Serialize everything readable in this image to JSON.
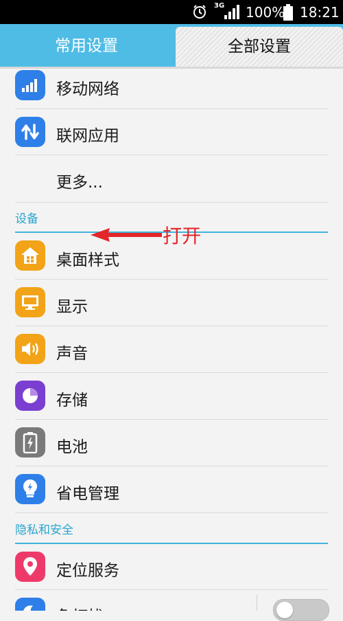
{
  "status_bar": {
    "network": "3G",
    "battery": "100%",
    "time": "18:21"
  },
  "tabs": [
    {
      "label": "常用设置",
      "active": false
    },
    {
      "label": "全部设置",
      "active": true
    }
  ],
  "items": {
    "mobile_network": "移动网络",
    "network_apps": "联网应用",
    "more": "更多...",
    "launcher_style": "桌面样式",
    "display": "显示",
    "sound": "声音",
    "storage": "存储",
    "battery": "电池",
    "power_saving": "省电管理",
    "location": "定位服务",
    "dnd": "免打扰"
  },
  "sections": {
    "device": "设备",
    "privacy": "隐私和安全"
  },
  "annotation": {
    "text": "打开",
    "color": "#e3262a"
  },
  "colors": {
    "accent": "#4fbce6",
    "section_text": "#28a6cf",
    "blue_icon": "#2f7fe8",
    "orange_icon": "#f2a317",
    "purple_icon": "#7a3fd0",
    "gray_icon": "#7a7a7a",
    "pink_icon": "#ee3a6a"
  },
  "icons": {
    "mobile_network": "signal-bars-icon",
    "network_apps": "up-down-arrows-icon",
    "launcher_style": "home-icon",
    "display": "monitor-icon",
    "sound": "speaker-icon",
    "storage": "pie-chart-icon",
    "battery": "battery-icon",
    "power_saving": "lightbulb-icon",
    "location": "location-pin-icon",
    "dnd": "moon-icon"
  }
}
